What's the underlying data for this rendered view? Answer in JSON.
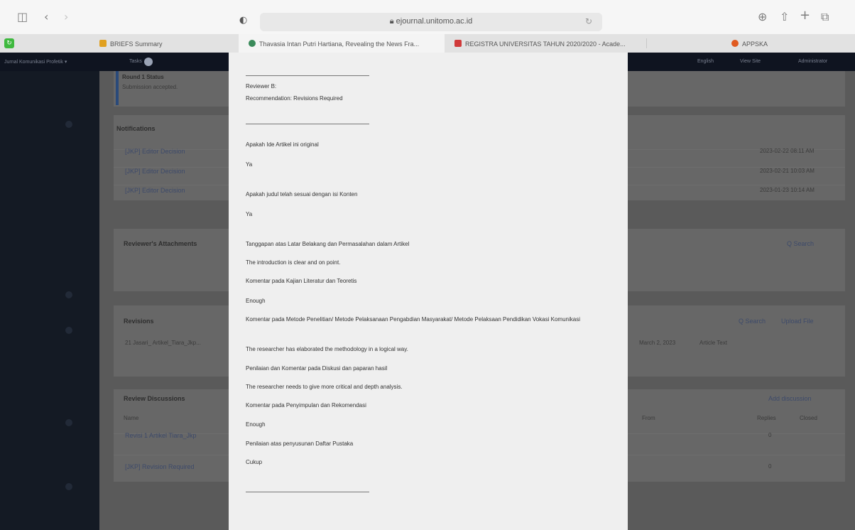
{
  "browser": {
    "url": "ejournal.unitomo.ac.id",
    "tabs": [
      {
        "label": "BRIEFS Summary"
      },
      {
        "label": "Thavasia Intan Putri Hartiana, Revealing the News Fra..."
      },
      {
        "label": "REGISTRA UNIVERSITAS TAHUN 2020/2020 - Acade..."
      },
      {
        "label": "APPSKA"
      }
    ]
  },
  "ojs_nav": {
    "site": "Jurnal Komunikasi Profetik ▾",
    "tasks_label": "Tasks",
    "tasks_count": "0",
    "right_items": [
      "English",
      "View Site",
      "Administrator"
    ]
  },
  "background_page": {
    "round_status_title": "Round 1 Status",
    "round_status_sub": "Submission accepted.",
    "notifications_title": "Notifications",
    "notifications": [
      {
        "label": "[JKP] Editor Decision",
        "date": "2023-02-22 08:11 AM"
      },
      {
        "label": "[JKP] Editor Decision",
        "date": "2023-02-21 10:03 AM"
      },
      {
        "label": "[JKP] Editor Decision",
        "date": "2023-01-23 10:14 AM"
      }
    ],
    "attachments_title": "Reviewer's Attachments",
    "search_label": "Q Search",
    "revisions_title": "Revisions",
    "revisions_row": "21 Jasari_ Artikel_Tiara_Jkp...",
    "revisions_date": "March 2, 2023",
    "revisions_type": "Article Text",
    "upload_file": "Upload File",
    "discussions_title": "Review Discussions",
    "add_discussion": "Add discussion",
    "discussion_cols": [
      "Name",
      "From",
      "Last Reply",
      "Replies",
      "Closed"
    ],
    "discussion_rows": [
      {
        "label": "Revisi 1 Artikel Tiara_Jkp",
        "replies": "0"
      },
      {
        "label": "[JKP] Revision Required",
        "replies": "0"
      }
    ]
  },
  "modal": {
    "reviewer": "Reviewer B:",
    "recommendation": "Recommendation: Revisions Required",
    "qa": [
      {
        "q": "Apakah Ide Artikel ini original",
        "a": "Ya"
      },
      {
        "q": "Apakah judul telah sesuai dengan isi Konten",
        "a": "Ya"
      }
    ],
    "lines": [
      "Tanggapan atas Latar Belakang dan Permasalahan dalam Artikel",
      "The introduction is clear and on point.",
      "Komentar pada Kajian Literatur dan Teoretis",
      "Enough",
      "Komentar pada Metode Penelitian/ Metode Pelaksanaan Pengabdian Masyarakat/ Metode Pelaksaan Pendidikan Vokasi Komunikasi",
      "The researcher has elaborated the methodology in a logical way.",
      "Penilaian dan Komentar pada Diskusi dan paparan hasil",
      "The researcher needs to give more critical and depth analysis.",
      "Komentar pada Penyimpulan dan Rekomendasi",
      "Enough",
      "Penilaian atas penyusunan Daftar Pustaka",
      "Cukup"
    ]
  }
}
